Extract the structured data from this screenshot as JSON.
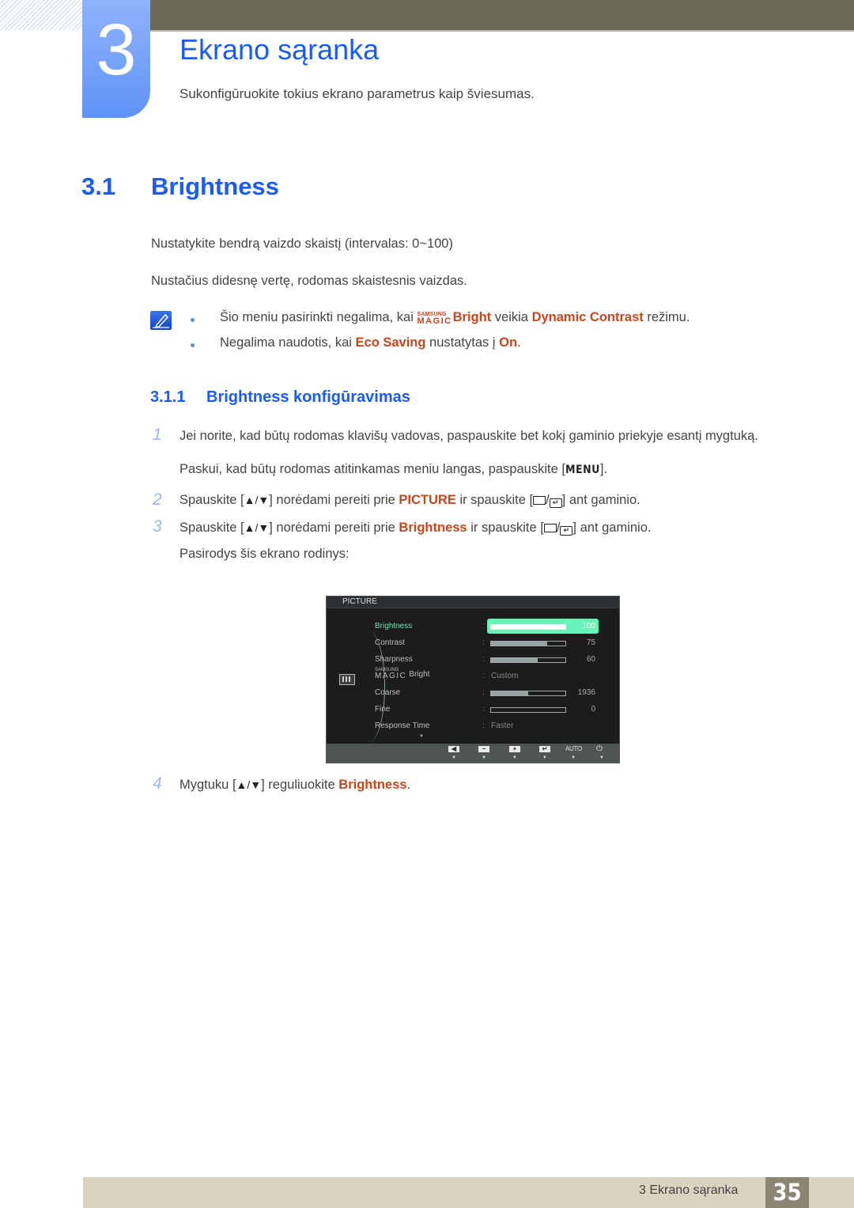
{
  "header": {
    "chapter_number": "3",
    "chapter_title": "Ekrano sąranka",
    "chapter_subtitle": "Sukonfigūruokite tokius ekrano parametrus kaip šviesumas."
  },
  "section": {
    "number": "3.1",
    "title": "Brightness",
    "paragraphs": [
      "Nustatykite bendrą vaizdo skaistį (intervalas: 0~100)",
      "Nustačius didesnę vertę, rodomas skaistesnis vaizdas."
    ]
  },
  "notes": {
    "icon": "note-pencil-icon",
    "items": [
      {
        "pre": "Šio meniu pasirinkti negalima, kai ",
        "logo_top": "SAMSUNG",
        "logo_bottom": "MAGIC",
        "hl1": "Bright",
        "mid": " veikia ",
        "hl2": "Dynamic Contrast",
        "post": " režimu."
      },
      {
        "pre": "Negalima naudotis, kai ",
        "hl1": "Eco Saving",
        "mid": " nustatytas į ",
        "hl2": "On",
        "post": "."
      }
    ]
  },
  "subsection": {
    "number": "3.1.1",
    "title": "Brightness konfigūravimas"
  },
  "steps": [
    {
      "num": "1",
      "line1": "Jei norite, kad būtų rodomas klavišų vadovas, paspauskite bet kokį gaminio priekyje esantį mygtuką.",
      "line2_pre": "Paskui, kad būtų rodomas atitinkamas meniu langas, paspauskite [",
      "line2_key": "MENU",
      "line2_post": "]."
    },
    {
      "num": "2",
      "pre": "Spauskite [",
      "arrows": "▲/▼",
      "mid1": "] norėdami pereiti prie ",
      "hl": "PICTURE",
      "mid2": " ir spauskite [",
      "slash": "/",
      "post": "] ant gaminio."
    },
    {
      "num": "3",
      "pre": "Spauskite [",
      "arrows": "▲/▼",
      "mid1": "] norėdami pereiti prie ",
      "hl": "Brightness",
      "mid2": " ir spauskite [",
      "slash": "/",
      "post": "] ant gaminio.",
      "after": "Pasirodys šis ekrano rodinys:"
    },
    {
      "num": "4",
      "pre": "Mygtuku [",
      "arrows": "▲/▼",
      "mid1": "] reguliuokite ",
      "hl": "Brightness",
      "post": "."
    }
  ],
  "osd": {
    "title": "PICTURE",
    "rows": [
      {
        "label": "Brightness",
        "type": "bar",
        "value": "100",
        "fraction": 1.0,
        "active": true
      },
      {
        "label": "Contrast",
        "type": "bar",
        "value": "75",
        "fraction": 0.75
      },
      {
        "label": "Sharpness",
        "type": "bar",
        "value": "60",
        "fraction": 0.63
      },
      {
        "label_logo_top": "SAMSUNG",
        "label_logo_bottom": "MAGIC",
        "label": "Bright",
        "type": "text",
        "value": "Custom"
      },
      {
        "label": "Coarse",
        "type": "bar",
        "value": "1936",
        "fraction": 0.5
      },
      {
        "label": "Fine",
        "type": "bar",
        "value": "0",
        "fraction": 0.0
      },
      {
        "label": "Response Time",
        "type": "text",
        "value": "Faster"
      }
    ],
    "scroll_indicator": "▼",
    "buttons": [
      {
        "name": "left-arrow-button",
        "glyph": "◀"
      },
      {
        "name": "minus-button",
        "glyph": "−"
      },
      {
        "name": "plus-button",
        "glyph": "+"
      },
      {
        "name": "enter-button",
        "glyph": "↵"
      },
      {
        "name": "auto-button",
        "glyph": "AUTO"
      },
      {
        "name": "power-button",
        "glyph": "⏻"
      }
    ],
    "button_arrow": "▼"
  },
  "footer": {
    "label": "3 Ekrano sąranka",
    "page": "35"
  },
  "colors": {
    "heading_blue": "#1a5cf2",
    "highlight_orange": "#c8461b",
    "osd_active_green": "#67f2b8",
    "top_bar": "#6c6b58",
    "footer_bar": "#d9d3bf",
    "page_box": "#8e8474"
  }
}
